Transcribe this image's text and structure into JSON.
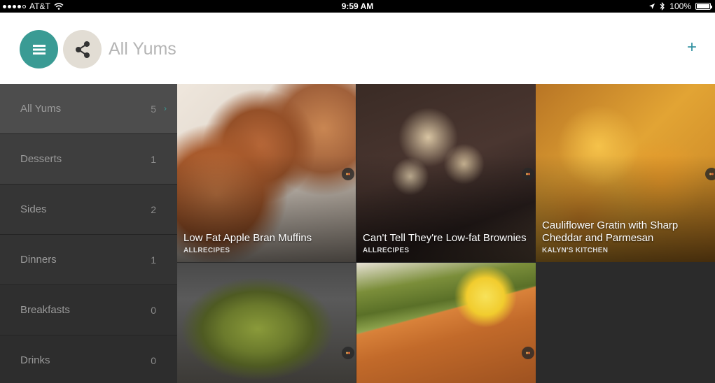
{
  "status_bar": {
    "carrier": "AT&T",
    "time": "9:59 AM",
    "battery": "100%",
    "battery_level": 1.0
  },
  "header": {
    "title": "All Yums",
    "add_label": "+"
  },
  "sidebar": {
    "items": [
      {
        "label": "All Yums",
        "count": "5",
        "selected": true,
        "chevron": "›"
      },
      {
        "label": "Desserts",
        "count": "1",
        "selected": false
      },
      {
        "label": "Sides",
        "count": "2",
        "selected": false
      },
      {
        "label": "Dinners",
        "count": "1",
        "selected": false
      },
      {
        "label": "Breakfasts",
        "count": "0",
        "selected": false
      },
      {
        "label": "Drinks",
        "count": "0",
        "selected": false
      }
    ]
  },
  "recipes": [
    {
      "title": "Low Fat Apple Bran Muffins",
      "source": "ALLRECIPES"
    },
    {
      "title": "Can't Tell They're Low-fat Brownies",
      "source": "ALLRECIPES"
    },
    {
      "title": "Cauliflower Gratin with Sharp Cheddar and Parmesan",
      "source": "KALYN'S KITCHEN"
    },
    {
      "title": "",
      "source": ""
    },
    {
      "title": "",
      "source": ""
    }
  ],
  "colors": {
    "accent": "#3a9b94",
    "add": "#2e8f9f",
    "sidebar_selected": "#4d4d4d"
  }
}
